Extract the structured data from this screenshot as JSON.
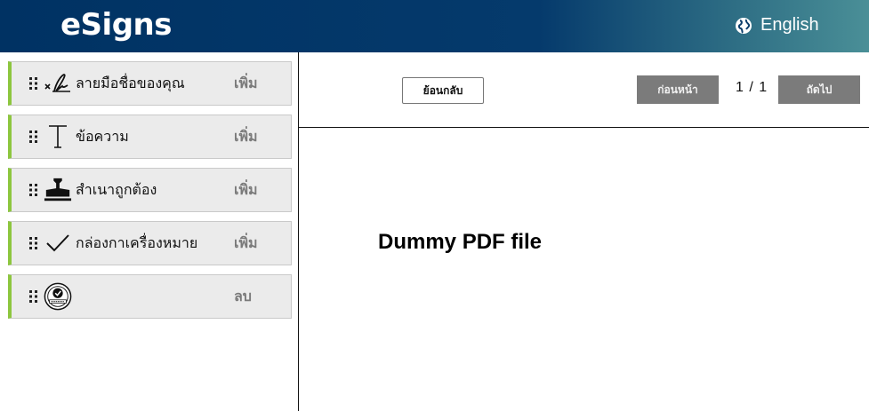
{
  "header": {
    "logo": "eSigns",
    "language": {
      "label": "English",
      "icon": "globe-icon"
    }
  },
  "colors": {
    "header_start": "#003263",
    "header_end": "#4a8f97",
    "field_accent": "#8dc63f",
    "field_bg": "#ebebeb",
    "nav_button_bg": "#7b7b7b"
  },
  "sidebar": {
    "fields": [
      {
        "icon": "signature-icon",
        "label": "ลายมือชื่อของคุณ",
        "action": "เพิ่ม"
      },
      {
        "icon": "text-icon",
        "label": "ข้อความ",
        "action": "เพิ่ม"
      },
      {
        "icon": "stamp-icon",
        "label": "สำเนาถูกต้อง",
        "action": "เพิ่ม"
      },
      {
        "icon": "checkmark-icon",
        "label": "กล่องกาเครื่องหมาย",
        "action": "เพิ่ม"
      },
      {
        "icon": "certified-badge-icon",
        "label": "",
        "action": "ลบ"
      }
    ]
  },
  "viewer": {
    "back_label": "ย้อนกลับ",
    "prev_label": "ก่อนหน้า",
    "next_label": "ถัดไป",
    "page_indicator": "1 / 1",
    "document_text": "Dummy PDF file"
  }
}
